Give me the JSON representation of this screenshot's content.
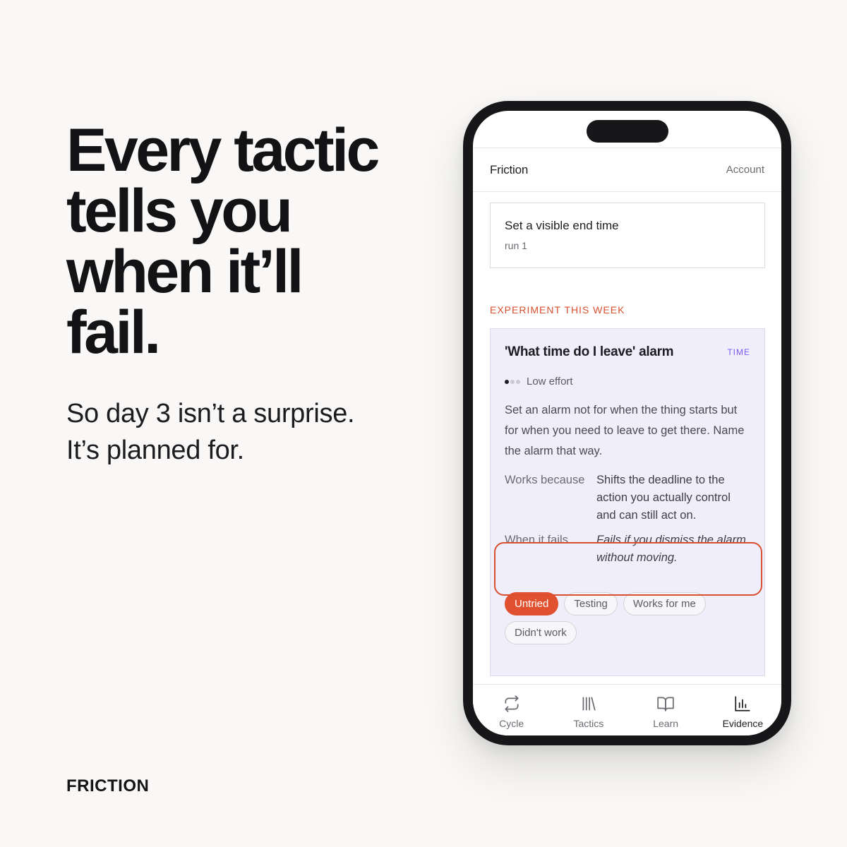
{
  "marketing": {
    "headline": "Every tactic\ntells you\nwhen it’ll\nfail.",
    "subline": "So day 3 isn’t a surprise.\nIt’s planned for.",
    "brand": "FRICTION"
  },
  "app": {
    "title": "Friction",
    "account_label": "Account"
  },
  "current_run": {
    "title": "Set a visible end time",
    "subtitle": "run 1"
  },
  "experiment": {
    "section_label": "EXPERIMENT THIS WEEK",
    "title": "'What time do I leave' alarm",
    "tag": "TIME",
    "effort_level": 1,
    "effort_max": 3,
    "effort_label": "Low effort",
    "description": "Set an alarm not for when the thing starts but for when you need to leave to get there. Name the alarm that way.",
    "works_because_label": "Works because",
    "works_because": "Shifts the deadline to the action you actually control and can still act on.",
    "fails_label": "When it fails",
    "fails": "Fails if you dismiss the alarm without moving.",
    "statuses": [
      {
        "label": "Untried",
        "active": true
      },
      {
        "label": "Testing",
        "active": false
      },
      {
        "label": "Works for me",
        "active": false
      },
      {
        "label": "Didn't work",
        "active": false
      }
    ]
  },
  "tabs": [
    {
      "label": "Cycle",
      "icon": "repeat-icon",
      "active": false
    },
    {
      "label": "Tactics",
      "icon": "library-icon",
      "active": false
    },
    {
      "label": "Learn",
      "icon": "book-open-icon",
      "active": false
    },
    {
      "label": "Evidence",
      "icon": "bar-chart-icon",
      "active": true
    }
  ],
  "colors": {
    "accent": "#e1512f",
    "tag": "#7a5cf0",
    "card_bg": "#f0eefa"
  }
}
